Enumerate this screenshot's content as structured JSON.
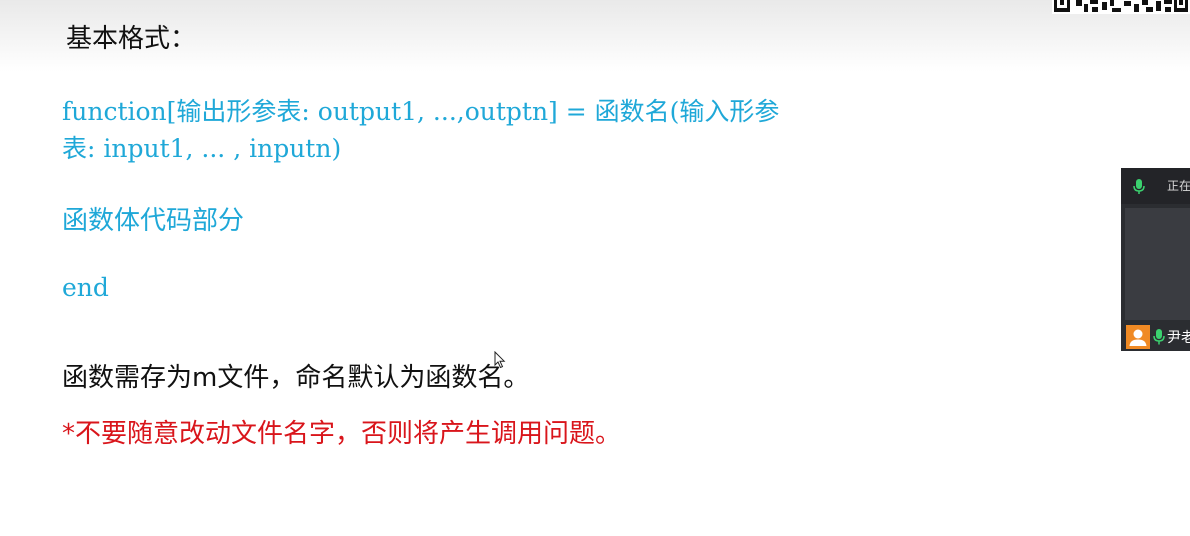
{
  "slide": {
    "heading": "基本格式：",
    "signature_line1": "function[输出形参表: output1, ...,outptn] = 函数名(输入形参",
    "signature_line2": "表: input1, ... , inputn)",
    "body_comment": "函数体代码部分",
    "end_keyword": "end",
    "note": "函数需存为m文件，命名默认为函数名。",
    "warning": "*不要随意改动文件名字，否则将产生调用问题。"
  },
  "meeting_panel": {
    "status_text": "正在",
    "participant_name": "尹老",
    "icons": [
      "mic-icon",
      "user-avatar-icon",
      "mic-active-icon"
    ]
  },
  "colors": {
    "code": "#1fa8d8",
    "warning": "#d9151b",
    "text": "#111111",
    "panel_bg": "#2b2d31",
    "avatar_bg": "#f08a24",
    "mic_active": "#3bd16f"
  }
}
